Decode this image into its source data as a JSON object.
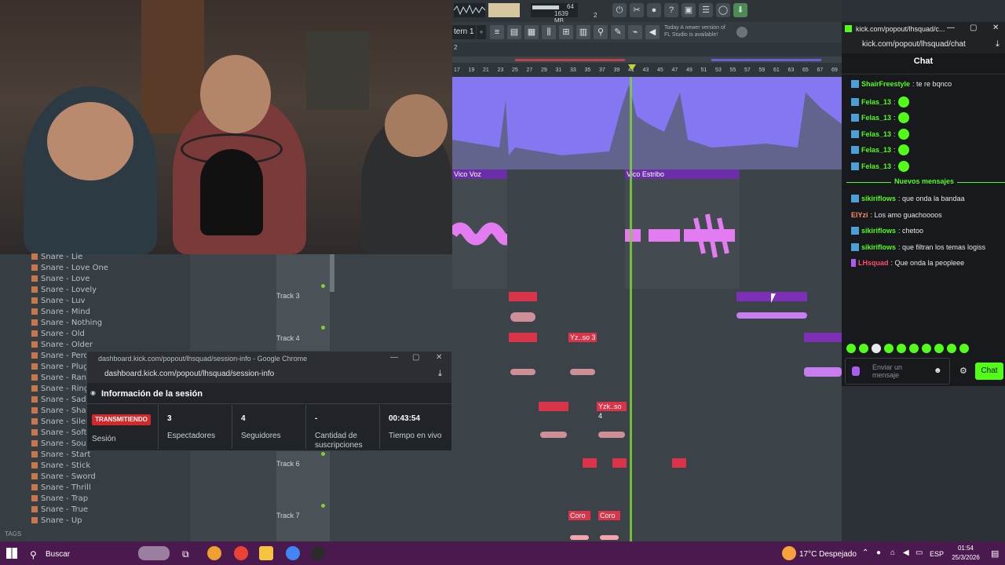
{
  "fl": {
    "cpu_value": "64",
    "mem_value": "1639 MB",
    "voices": "2",
    "pattern_label": "tern 1",
    "hint_text": "Today  A newer version of\nFL Studio is available!",
    "ruler_marks": [
      "17",
      "19",
      "21",
      "23",
      "25",
      "27",
      "29",
      "31",
      "33",
      "35",
      "37",
      "39",
      "41",
      "43",
      "45",
      "47",
      "49",
      "51",
      "53",
      "55",
      "57",
      "59",
      "61",
      "63",
      "65",
      "67",
      "69"
    ],
    "clip_vico_voz": "Vico Voz",
    "clip_vico_estribo": "Vico Estribo",
    "clip_yz_so3": "Yz..so 3",
    "clip_yzk_so4": "Yzk..so 4",
    "clip_coro_1": "Coro",
    "clip_coro_2": "Coro",
    "track3": "Track 3",
    "track4": "Track 4",
    "track6": "Track 6",
    "track7": "Track 7",
    "marker_2": "2"
  },
  "browser": {
    "items": [
      "Snare - Lie",
      "Snare - Love One",
      "Snare - Love",
      "Snare - Lovely",
      "Snare - Luv",
      "Snare - Mind",
      "Snare - Nothing",
      "Snare - Old",
      "Snare - Older",
      "Snare - Percus",
      "Snare - Plugg",
      "Snare - Rando",
      "Snare - Ring",
      "Snare - Sad",
      "Snare - Shake",
      "Snare - Silent",
      "Snare - Soft",
      "Snare - South",
      "Snare - Start",
      "Snare - Stick",
      "Snare - Sword",
      "Snare - Thrill",
      "Snare - Trap",
      "Snare - True",
      "Snare - Up"
    ],
    "tags_label": "TAGS"
  },
  "session": {
    "window_title": "dashboard.kick.com/popout/lhsquad/session-info - Google Chrome",
    "url": "dashboard.kick.com/popout/lhsquad/session-info",
    "heading": "Información de la sesión",
    "status": "TRANSMITIENDO",
    "status_label": "Sesión",
    "viewers": "3",
    "viewers_label": "Espectadores",
    "followers": "4",
    "followers_label": "Seguidores",
    "subs": "-",
    "subs_label": "Cantidad de suscripciones",
    "live_time": "00:43:54",
    "live_label": "Tiempo en vivo"
  },
  "chat": {
    "window_title": "kick.com/popout/lhsquad/c...",
    "url": "kick.com/popout/lhsquad/chat",
    "heading": "Chat",
    "messages_top": [
      {
        "user": "ShairFreestyle",
        "text": ": te re bqnco"
      },
      {
        "user": "Felas_13",
        "text": ":"
      },
      {
        "user": "Felas_13",
        "text": ":"
      },
      {
        "user": "Felas_13",
        "text": ":"
      },
      {
        "user": "Felas_13",
        "text": ":"
      },
      {
        "user": "Felas_13",
        "text": ":"
      }
    ],
    "new_messages_label": "Nuevos mensajes",
    "messages_bottom": [
      {
        "user": "sikiriflows",
        "text": ": que onda la bandaa",
        "color": "#53fc18"
      },
      {
        "user": "ElYzi",
        "text": ": Los amo guachoooos",
        "color": "#ff8a65"
      },
      {
        "user": "sikiriflows",
        "text": ": chetoo",
        "color": "#53fc18"
      },
      {
        "user": "sikiriflows",
        "text": ": que filtran los temas logiss",
        "color": "#53fc18"
      },
      {
        "user": "LHsquad",
        "text": ": Que onda la peopleee",
        "color": "#ff4d6a"
      }
    ],
    "input_placeholder": "Enviar un mensaje",
    "send_label": "Chat"
  },
  "taskbar": {
    "search_label": "Buscar",
    "weather": "17°C  Despejado",
    "lang": "ESP",
    "time": "01:54",
    "date": "25/3/2026"
  },
  "colors": {
    "kick_green": "#53fc18",
    "clip_purple": "#8577f2",
    "clip_red": "#d9344a",
    "clip_magenta": "#b84fe0",
    "live_red": "#d62828"
  }
}
